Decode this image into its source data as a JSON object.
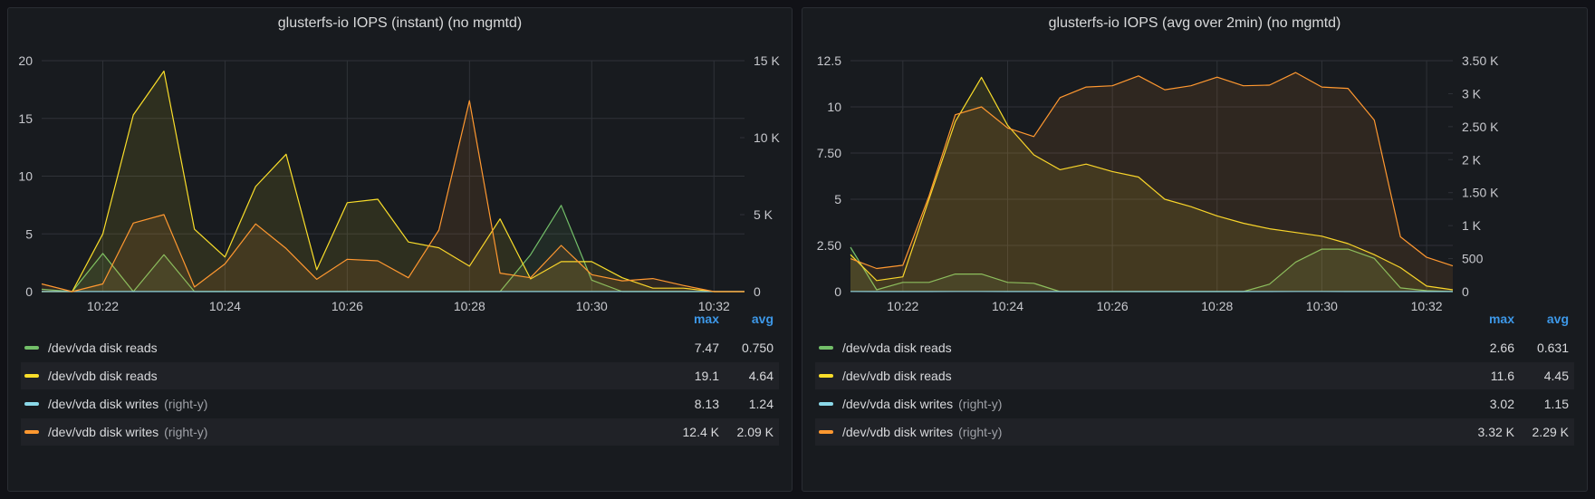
{
  "panels": [
    {
      "title": "glusterfs-io IOPS (instant) (no mgmtd)",
      "legend_headers": {
        "max": "max",
        "avg": "avg"
      },
      "legend": [
        {
          "name": "/dev/vda disk reads",
          "axis_note": "",
          "max": "7.47",
          "avg": "0.750",
          "color": "#73bf69"
        },
        {
          "name": "/dev/vdb disk reads",
          "axis_note": "",
          "max": "19.1",
          "avg": "4.64",
          "color": "#fade2a"
        },
        {
          "name": "/dev/vda disk writes",
          "axis_note": "(right-y)",
          "max": "8.13",
          "avg": "1.24",
          "color": "#8ad8e8"
        },
        {
          "name": "/dev/vdb disk writes",
          "axis_note": "(right-y)",
          "max": "12.4 K",
          "avg": "2.09 K",
          "color": "#ff9830"
        }
      ]
    },
    {
      "title": "glusterfs-io IOPS (avg over 2min) (no mgmtd)",
      "legend_headers": {
        "max": "max",
        "avg": "avg"
      },
      "legend": [
        {
          "name": "/dev/vda disk reads",
          "axis_note": "",
          "max": "2.66",
          "avg": "0.631",
          "color": "#73bf69"
        },
        {
          "name": "/dev/vdb disk reads",
          "axis_note": "",
          "max": "11.6",
          "avg": "4.45",
          "color": "#fade2a"
        },
        {
          "name": "/dev/vda disk writes",
          "axis_note": "(right-y)",
          "max": "3.02",
          "avg": "1.15",
          "color": "#8ad8e8"
        },
        {
          "name": "/dev/vdb disk writes",
          "axis_note": "(right-y)",
          "max": "3.32 K",
          "avg": "2.29 K",
          "color": "#ff9830"
        }
      ]
    }
  ],
  "chart_data": [
    {
      "type": "area",
      "title": "glusterfs-io IOPS (instant) (no mgmtd)",
      "x": [
        "10:20:30",
        "10:21",
        "10:21:30",
        "10:22",
        "10:22:30",
        "10:23",
        "10:23:30",
        "10:24",
        "10:24:30",
        "10:25",
        "10:25:30",
        "10:26",
        "10:26:30",
        "10:27",
        "10:27:30",
        "10:28",
        "10:28:30",
        "10:29",
        "10:29:30",
        "10:30",
        "10:30:30",
        "10:31",
        "10:31:30",
        "10:32"
      ],
      "x_ticks": [
        "10:22",
        "10:24",
        "10:26",
        "10:28",
        "10:30",
        "10:32"
      ],
      "y_left": {
        "ticks": [
          "0",
          "5",
          "10",
          "15",
          "20"
        ],
        "range": [
          0,
          20
        ]
      },
      "y_right": {
        "ticks": [
          "0",
          "5 K",
          "10 K",
          "15 K"
        ],
        "range": [
          0,
          15000
        ]
      },
      "grid": true,
      "series": [
        {
          "name": "/dev/vda disk reads",
          "axis": "left",
          "color": "#73bf69",
          "values": [
            0.2,
            0,
            3.3,
            0,
            3.2,
            0,
            0,
            0,
            0,
            0,
            0,
            0,
            0,
            0,
            0,
            0,
            3.2,
            7.47,
            1.0,
            0,
            0,
            0,
            0,
            0
          ]
        },
        {
          "name": "/dev/vdb disk reads",
          "axis": "left",
          "color": "#fade2a",
          "values": [
            0,
            0,
            5,
            15.3,
            19.1,
            5.4,
            3,
            9.1,
            11.9,
            1.9,
            7.7,
            8,
            4.3,
            3.8,
            2.2,
            6.3,
            1.1,
            2.6,
            2.6,
            1.2,
            0.3,
            0.3,
            0,
            0
          ]
        },
        {
          "name": "/dev/vda disk writes",
          "axis": "right",
          "color": "#8ad8e8",
          "values": [
            8,
            5,
            5,
            6,
            6,
            7,
            5,
            6,
            6,
            5,
            6,
            7,
            6,
            6,
            5,
            5,
            5,
            6,
            8,
            6,
            5,
            5,
            5,
            5
          ]
        },
        {
          "name": "/dev/vdb disk writes",
          "axis": "right",
          "color": "#ff9830",
          "values": [
            500,
            0,
            500,
            4450,
            5000,
            300,
            1800,
            4400,
            2800,
            800,
            2100,
            2000,
            900,
            4000,
            12400,
            1200,
            900,
            3000,
            1100,
            700,
            850,
            400,
            0,
            0
          ]
        }
      ]
    },
    {
      "type": "area",
      "title": "glusterfs-io IOPS (avg over 2min) (no mgmtd)",
      "x": [
        "10:20:30",
        "10:21",
        "10:21:30",
        "10:22",
        "10:22:30",
        "10:23",
        "10:23:30",
        "10:24",
        "10:24:30",
        "10:25",
        "10:25:30",
        "10:26",
        "10:26:30",
        "10:27",
        "10:27:30",
        "10:28",
        "10:28:30",
        "10:29",
        "10:29:30",
        "10:30",
        "10:30:30",
        "10:31",
        "10:31:30",
        "10:32"
      ],
      "x_ticks": [
        "10:22",
        "10:24",
        "10:26",
        "10:28",
        "10:30",
        "10:32"
      ],
      "y_left": {
        "ticks": [
          "0",
          "2.50",
          "5",
          "7.50",
          "10",
          "12.5"
        ],
        "range": [
          0,
          12.5
        ]
      },
      "y_right": {
        "ticks": [
          "0",
          "500",
          "1 K",
          "1.50 K",
          "2 K",
          "2.50 K",
          "3 K",
          "3.50 K"
        ],
        "range": [
          0,
          3500
        ]
      },
      "grid": true,
      "series": [
        {
          "name": "/dev/vda disk reads",
          "axis": "left",
          "color": "#73bf69",
          "values": [
            2.4,
            0.1,
            0.5,
            0.5,
            0.95,
            0.95,
            0.5,
            0.45,
            0,
            0,
            0,
            0,
            0,
            0,
            0,
            0,
            0.4,
            1.6,
            2.3,
            2.3,
            1.8,
            0.2,
            0.05,
            0
          ]
        },
        {
          "name": "/dev/vdb disk reads",
          "axis": "left",
          "color": "#fade2a",
          "values": [
            2,
            0.6,
            0.8,
            5,
            9.2,
            11.6,
            9,
            7.4,
            6.6,
            6.9,
            6.5,
            6.2,
            5,
            4.6,
            4.1,
            3.7,
            3.4,
            3.2,
            3,
            2.6,
            2,
            1.3,
            0.3,
            0.1
          ]
        },
        {
          "name": "/dev/vda disk writes",
          "axis": "right",
          "color": "#8ad8e8",
          "values": [
            3,
            2,
            2,
            2,
            3,
            3,
            2,
            2,
            2,
            2,
            3,
            2,
            2,
            2,
            2,
            2,
            2,
            3,
            3,
            2,
            2,
            2,
            2,
            2
          ]
        },
        {
          "name": "/dev/vdb disk writes",
          "axis": "right",
          "color": "#ff9830",
          "values": [
            500,
            350,
            400,
            1450,
            2680,
            2800,
            2480,
            2350,
            2940,
            3100,
            3120,
            3270,
            3060,
            3120,
            3250,
            3120,
            3130,
            3320,
            3100,
            3080,
            2600,
            830,
            520,
            390
          ]
        }
      ]
    }
  ]
}
